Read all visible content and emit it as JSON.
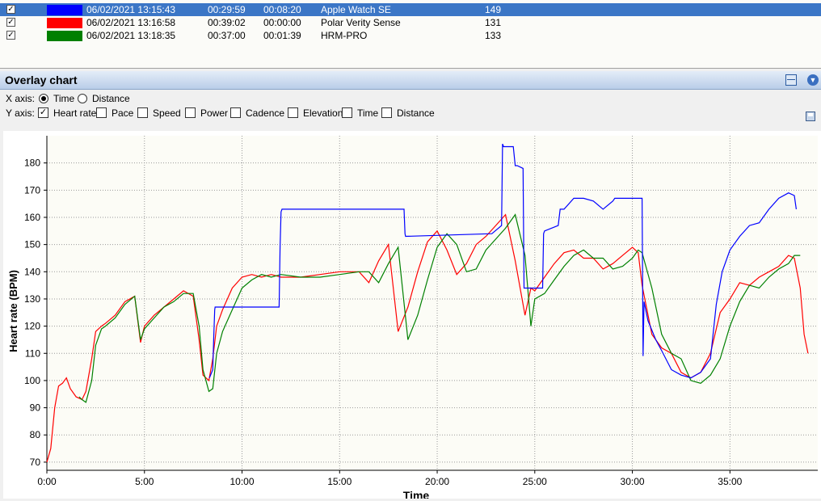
{
  "activities": [
    {
      "checked": true,
      "color": "#0000ff",
      "date": "06/02/2021 13:15:43",
      "duration": "00:29:59",
      "offset": "00:08:20",
      "device": "Apple Watch SE",
      "avg_hr": "149",
      "selected": true
    },
    {
      "checked": true,
      "color": "#ff0000",
      "date": "06/02/2021 13:16:58",
      "duration": "00:39:02",
      "offset": "00:00:00",
      "device": "Polar Verity Sense",
      "avg_hr": "131",
      "selected": false
    },
    {
      "checked": true,
      "color": "#008000",
      "date": "06/02/2021 13:18:35",
      "duration": "00:37:00",
      "offset": "00:01:39",
      "device": "HRM-PRO",
      "avg_hr": "133",
      "selected": false
    }
  ],
  "panel": {
    "title": "Overlay chart",
    "x_axis_label": "X axis:",
    "y_axis_label": "Y axis:",
    "x_options": [
      {
        "label": "Time",
        "selected": true
      },
      {
        "label": "Distance",
        "selected": false
      }
    ],
    "y_options": [
      {
        "label": "Heart rate",
        "checked": true
      },
      {
        "label": "Pace",
        "checked": false
      },
      {
        "label": "Speed",
        "checked": false
      },
      {
        "label": "Power",
        "checked": false
      },
      {
        "label": "Cadence",
        "checked": false
      },
      {
        "label": "Elevation",
        "checked": false
      },
      {
        "label": "Time",
        "checked": false
      },
      {
        "label": "Distance",
        "checked": false
      }
    ]
  },
  "chart_data": {
    "type": "line",
    "xlabel": "Time",
    "ylabel": "Heart rate (BPM)",
    "xlim": [
      0,
      39.5
    ],
    "ylim": [
      67,
      190
    ],
    "x_ticks": [
      0,
      5,
      10,
      15,
      20,
      25,
      30,
      35
    ],
    "x_tick_labels": [
      "0:00",
      "5:00",
      "10:00",
      "15:00",
      "20:00",
      "25:00",
      "30:00",
      "35:00"
    ],
    "y_ticks": [
      70,
      80,
      90,
      100,
      110,
      120,
      130,
      140,
      150,
      160,
      170,
      180
    ],
    "grid": true,
    "series": [
      {
        "name": "Polar Verity Sense",
        "color": "#ff0000",
        "x": [
          0,
          0.2,
          0.4,
          0.6,
          0.8,
          1.0,
          1.2,
          1.5,
          1.8,
          2.0,
          2.3,
          2.5,
          2.8,
          3.0,
          3.5,
          4.0,
          4.5,
          4.8,
          5.0,
          5.5,
          6.0,
          6.5,
          7.0,
          7.5,
          7.8,
          8.0,
          8.3,
          8.5,
          8.7,
          9.0,
          9.5,
          10.0,
          10.5,
          11.0,
          11.5,
          12.0,
          13.0,
          14.0,
          15.0,
          16.0,
          16.5,
          17.0,
          17.5,
          18.0,
          18.5,
          19.0,
          19.5,
          20.0,
          20.5,
          21.0,
          21.5,
          22.0,
          22.5,
          23.0,
          23.5,
          24.0,
          24.5,
          24.8,
          25.0,
          25.5,
          26.0,
          26.5,
          27.0,
          27.5,
          28.0,
          28.5,
          29.0,
          29.5,
          30.0,
          30.3,
          30.5,
          31.0,
          31.5,
          32.0,
          32.5,
          33.0,
          33.5,
          34.0,
          34.5,
          35.0,
          35.5,
          36.0,
          36.5,
          37.0,
          37.5,
          38.0,
          38.3,
          38.6,
          38.8,
          39.0
        ],
        "y": [
          70,
          75,
          90,
          98,
          99,
          101,
          97,
          94,
          93,
          96,
          108,
          118,
          120,
          121,
          124,
          129,
          131,
          114,
          120,
          124,
          127,
          130,
          133,
          131,
          115,
          102,
          100,
          108,
          120,
          126,
          134,
          138,
          139,
          138,
          139,
          138,
          138,
          139,
          140,
          140,
          136,
          144,
          150,
          118,
          127,
          140,
          151,
          155,
          148,
          139,
          143,
          150,
          153,
          157,
          161,
          144,
          124,
          134,
          133,
          138,
          143,
          147,
          148,
          145,
          145,
          141,
          143,
          146,
          149,
          147,
          135,
          117,
          112,
          110,
          103,
          101,
          103,
          110,
          125,
          130,
          136,
          135,
          138,
          140,
          142,
          146,
          145,
          134,
          117,
          110
        ]
      },
      {
        "name": "HRM-PRO",
        "color": "#008000",
        "x": [
          1.65,
          1.8,
          2.0,
          2.3,
          2.5,
          2.8,
          3.0,
          3.5,
          4.0,
          4.5,
          4.8,
          5.0,
          5.5,
          6.0,
          6.5,
          7.0,
          7.5,
          7.8,
          8.0,
          8.3,
          8.5,
          8.7,
          9.0,
          9.5,
          10.0,
          10.5,
          11.0,
          11.5,
          12.0,
          13.0,
          14.0,
          15.0,
          16.0,
          16.5,
          17.0,
          17.5,
          18.0,
          18.5,
          19.0,
          19.5,
          20.0,
          20.5,
          21.0,
          21.5,
          22.0,
          22.5,
          23.0,
          23.5,
          24.0,
          24.5,
          24.8,
          25.0,
          25.5,
          26.0,
          26.5,
          27.0,
          27.5,
          28.0,
          28.5,
          29.0,
          29.5,
          30.0,
          30.3,
          30.5,
          31.0,
          31.5,
          32.0,
          32.5,
          33.0,
          33.5,
          34.0,
          34.5,
          35.0,
          35.5,
          36.0,
          36.5,
          37.0,
          37.5,
          38.0,
          38.3,
          38.6
        ],
        "y": [
          94,
          93,
          92,
          100,
          113,
          119,
          120,
          123,
          128,
          131,
          115,
          119,
          123,
          127,
          129,
          132,
          132,
          120,
          104,
          96,
          97,
          110,
          118,
          126,
          134,
          137,
          139,
          138,
          139,
          138,
          138,
          139,
          140,
          140,
          136,
          143,
          149,
          115,
          124,
          137,
          149,
          154,
          150,
          140,
          141,
          148,
          152,
          156,
          161,
          146,
          120,
          130,
          132,
          137,
          142,
          146,
          148,
          145,
          145,
          141,
          142,
          145,
          148,
          147,
          134,
          117,
          110,
          108,
          100,
          99,
          102,
          108,
          120,
          129,
          135,
          134,
          138,
          141,
          143,
          146,
          146
        ]
      },
      {
        "name": "Apple Watch SE",
        "color": "#0000ff",
        "x": [
          8.33,
          8.5,
          8.55,
          8.6,
          8.62,
          8.65,
          8.7,
          8.72,
          11.9,
          11.95,
          12.0,
          12.05,
          18.3,
          18.35,
          18.38,
          22.8,
          23.3,
          23.35,
          23.4,
          23.9,
          24.0,
          24.1,
          24.4,
          24.45,
          24.5,
          25.4,
          25.45,
          25.5,
          26.2,
          26.3,
          26.5,
          27.0,
          27.5,
          28.0,
          28.5,
          29.0,
          29.1,
          30.5,
          30.55,
          30.6,
          30.8,
          31.2,
          31.5,
          32.0,
          32.5,
          33.0,
          33.5,
          34.0,
          34.3,
          34.6,
          35.0,
          35.5,
          36.0,
          36.5,
          37.0,
          37.5,
          38.0,
          38.3,
          38.4
        ],
        "y": [
          101,
          104,
          116,
          126,
          127,
          127,
          127,
          127,
          127,
          149,
          162,
          163,
          163,
          154,
          153,
          154,
          157,
          187,
          186,
          186,
          179,
          179,
          178,
          134,
          134,
          134,
          154,
          155,
          157,
          163,
          163,
          167,
          167,
          166,
          163,
          166,
          167,
          167,
          109,
          129,
          122,
          115,
          111,
          104,
          102,
          101,
          103,
          108,
          128,
          140,
          148,
          153,
          157,
          158,
          163,
          167,
          169,
          168,
          163
        ]
      }
    ]
  }
}
